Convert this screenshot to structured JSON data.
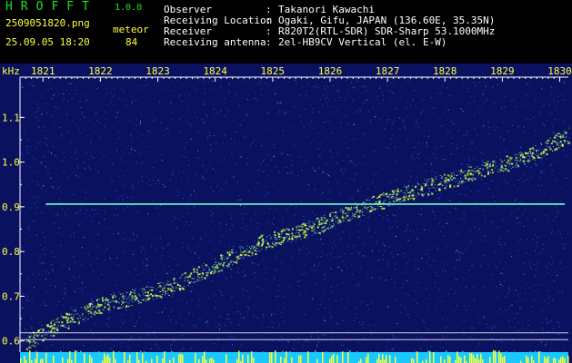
{
  "app": {
    "title": "HROFFT",
    "version": "1.0.0",
    "file_name": "2509051820.png",
    "timestamp": "25.09.05 18:20",
    "meteor_label": "meteor",
    "meteor_count": "84"
  },
  "info": [
    {
      "label": "Observer",
      "sep": ":",
      "value": "Takanori Kawachi"
    },
    {
      "label": "Receiving Location",
      "sep": ":",
      "value": "Ogaki, Gifu, JAPAN (136.60E, 35.35N)"
    },
    {
      "label": "Receiver",
      "sep": ":",
      "value": "R820T2(RTL-SDR) SDR-Sharp 53.1000MHz"
    },
    {
      "label": "Receiving antenna",
      "sep": ":",
      "value": "2el-HB9CV Vertical (el. E-W)"
    }
  ],
  "colors": {
    "title": "#20e020",
    "text_yellow": "#ffff40",
    "text_white": "#ffffff",
    "background": "#0a1260",
    "noise": "#2a6cff",
    "trace": "#d8ff40",
    "carrier": "#70ffd0",
    "axis": "#ffffff",
    "floor": "#18c8ff",
    "floor_peaks": "#ffff30"
  },
  "chart_data": {
    "type": "heatmap",
    "y_unit": "kHz",
    "x_ticks": [
      "1821",
      "1822",
      "1823",
      "1824",
      "1825",
      "1826",
      "1827",
      "1828",
      "1829",
      "1830"
    ],
    "x_range": [
      1820.6,
      1830.15
    ],
    "y_ticks": [
      "1.1",
      "1.0",
      "0.9",
      "0.8",
      "0.7",
      "0.6"
    ],
    "y_range": [
      0.575,
      1.19
    ],
    "carrier_khz": 0.906,
    "carrier_start": 1821.05,
    "reference_lines_khz": [
      0.618,
      0.603
    ],
    "drift_trace": [
      [
        1820.7,
        0.595
      ],
      [
        1821.3,
        0.64
      ],
      [
        1822.0,
        0.68
      ],
      [
        1822.6,
        0.7
      ],
      [
        1823.2,
        0.72
      ],
      [
        1824.0,
        0.77
      ],
      [
        1824.8,
        0.82
      ],
      [
        1825.6,
        0.85
      ],
      [
        1826.2,
        0.88
      ],
      [
        1826.8,
        0.91
      ],
      [
        1827.3,
        0.93
      ],
      [
        1827.8,
        0.95
      ],
      [
        1828.6,
        0.98
      ],
      [
        1829.4,
        1.01
      ],
      [
        1830.15,
        1.06
      ]
    ]
  }
}
